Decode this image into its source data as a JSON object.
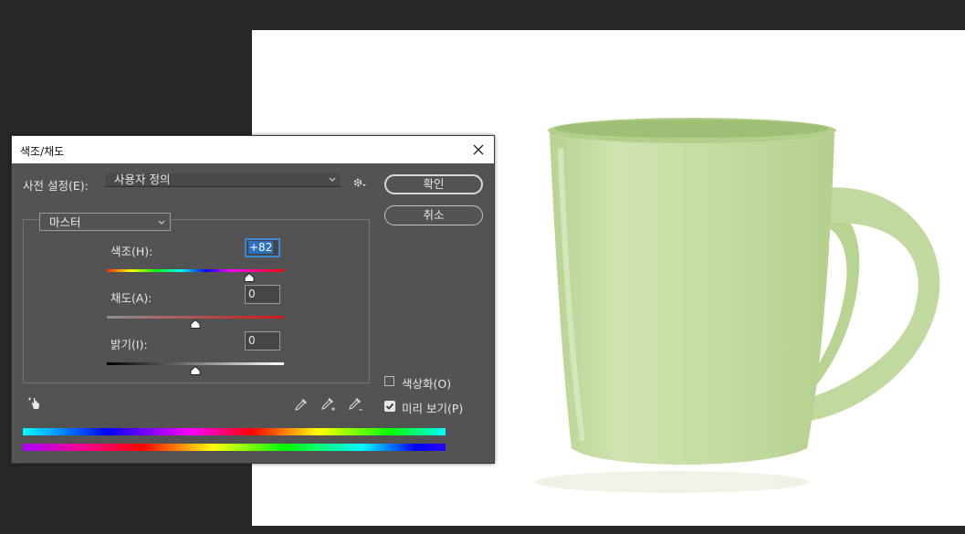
{
  "dialog": {
    "title": "색조/채도",
    "preset_label": "사전 설정(E):",
    "preset_value": "사용자 정의",
    "ok_label": "확인",
    "cancel_label": "취소",
    "channel_value": "마스터",
    "hue": {
      "label": "색조(H):",
      "value": "+82",
      "slider_fraction": 0.805
    },
    "saturation": {
      "label": "채도(A):",
      "value": "0",
      "slider_fraction": 0.5
    },
    "lightness": {
      "label": "밝기(I):",
      "value": "0",
      "slider_fraction": 0.5
    },
    "colorize_label": "색상화(O)",
    "colorize_checked": false,
    "preview_label": "미리 보기(P)",
    "preview_checked": true
  },
  "icons": [
    "close-icon",
    "gear-icon",
    "chevron-down-icon",
    "hand-target-icon",
    "eyedropper-icon",
    "eyedropper-plus-icon",
    "eyedropper-minus-icon",
    "checkmark-icon"
  ],
  "colors": {
    "dialog_bg": "#535353",
    "workspace_bg": "#282828",
    "canvas_bg": "#ffffff",
    "mug_green": "#c3dba0"
  }
}
